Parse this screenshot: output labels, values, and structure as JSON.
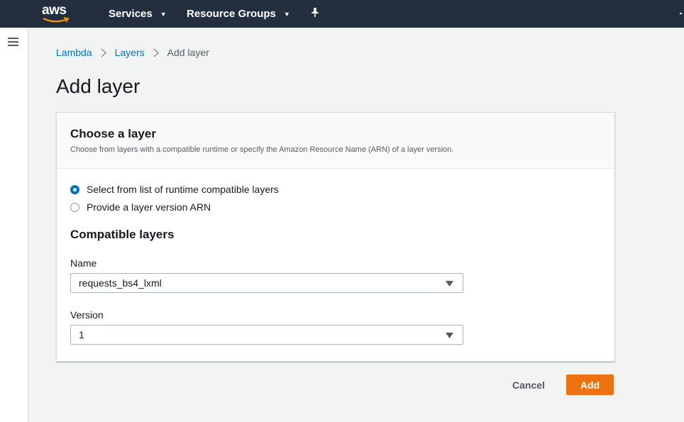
{
  "topnav": {
    "logo_text": "aws",
    "services_label": "Services",
    "resource_groups_label": "Resource Groups"
  },
  "breadcrumb": {
    "items": [
      "Lambda",
      "Layers",
      "Add layer"
    ]
  },
  "page": {
    "title": "Add layer"
  },
  "card": {
    "title": "Choose a layer",
    "description": "Choose from layers with a compatible runtime or specify the Amazon Resource Name (ARN) of a layer version.",
    "radio_options": [
      {
        "label": "Select from list of runtime compatible layers",
        "checked": true
      },
      {
        "label": "Provide a layer version ARN",
        "checked": false
      }
    ],
    "section_title": "Compatible layers",
    "name_label": "Name",
    "name_value": "requests_bs4_lxml",
    "version_label": "Version",
    "version_value": "1"
  },
  "actions": {
    "cancel_label": "Cancel",
    "add_label": "Add"
  },
  "colors": {
    "nav_bg": "#232f3e",
    "link": "#0073bb",
    "primary_button": "#ec7211",
    "logo_smile": "#ff9900"
  },
  "icons": [
    "hamburger-menu-icon",
    "chevron-down-icon",
    "pin-icon",
    "chevron-right-icon",
    "dropdown-arrow-icon"
  ]
}
